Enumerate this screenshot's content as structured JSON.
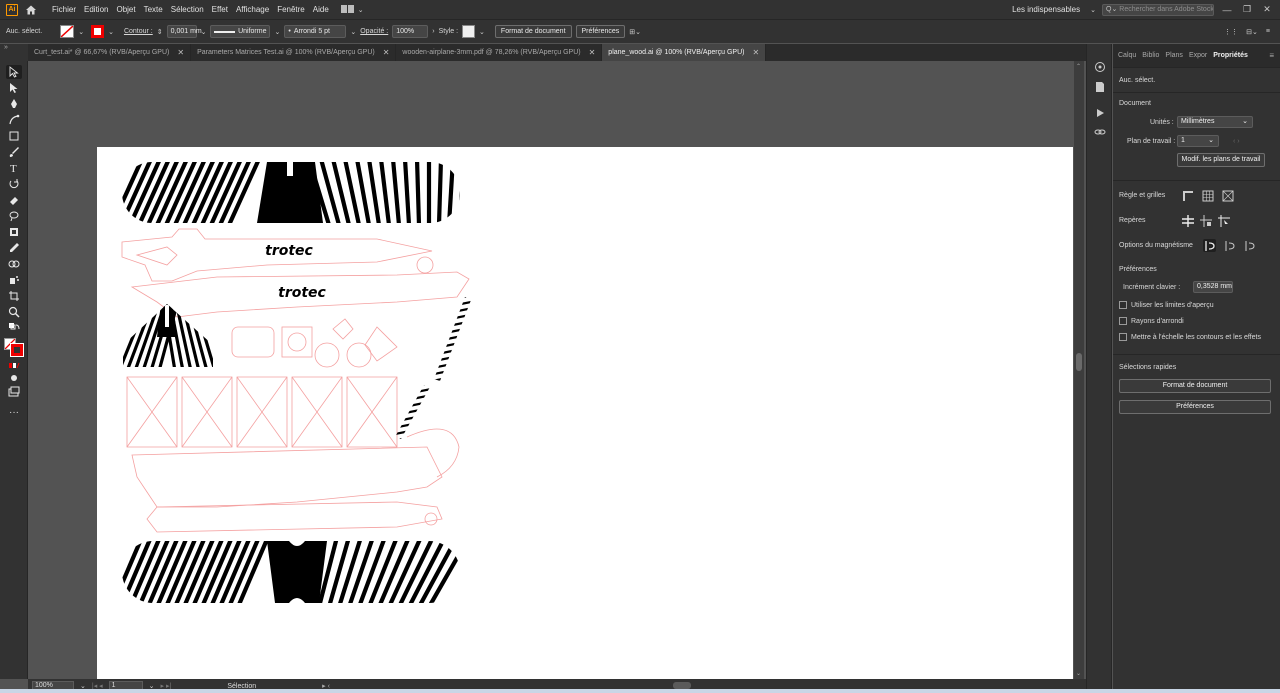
{
  "app": {
    "logo": "Ai"
  },
  "menu": [
    "Fichier",
    "Edition",
    "Objet",
    "Texte",
    "Sélection",
    "Effet",
    "Affichage",
    "Fenêtre",
    "Aide"
  ],
  "workspace": {
    "label": "Les indispensables",
    "search_placeholder": "Rechercher dans Adobe Stock"
  },
  "control": {
    "selection": "Auc. sélect.",
    "stroke_label": "Contour :",
    "stroke_weight": "0,001 mm",
    "profile": "Uniforme",
    "brush": "Arrondi 5 pt",
    "opacity_label": "Opacité :",
    "opacity": "100%",
    "style_label": "Style :",
    "doc_setup": "Format de document",
    "prefs": "Préférences"
  },
  "tabs": [
    {
      "label": "Curt_test.ai* @ 66,67% (RVB/Aperçu GPU)"
    },
    {
      "label": "Parameters Matrices Test.ai @ 100% (RVB/Aperçu GPU)"
    },
    {
      "label": "wooden-airplane-3mm.pdf @ 78,26% (RVB/Aperçu GPU)"
    },
    {
      "label": "plane_wood.ai @ 100% (RVB/Aperçu GPU)"
    }
  ],
  "artwork": {
    "text1": "trotec",
    "text2": "trotec"
  },
  "status": {
    "zoom": "100%",
    "artboard": "1",
    "tool": "Sélection"
  },
  "panel": {
    "tabs": [
      "Calqu",
      "Biblio",
      "Plans",
      "Expor",
      "Propriétés"
    ],
    "no_selection": "Auc. sélect.",
    "document_title": "Document",
    "units_label": "Unités :",
    "units_value": "Millimètres",
    "artboard_label": "Plan de travail :",
    "artboard_value": "1",
    "edit_artboards": "Modif. les plans de travail",
    "rulers_grids": "Règle et grilles",
    "guides": "Repères",
    "snap_options": "Options du magnétisme",
    "preferences_title": "Préférences",
    "key_increment_label": "Incrément clavier :",
    "key_increment_value": "0,3528 mm",
    "check1": "Utiliser les limites d'aperçu",
    "check2": "Rayons d'arrondi",
    "check3": "Mettre à l'échelle les contours et les effets",
    "quick_actions": "Sélections rapides",
    "btn_doc": "Format de document",
    "btn_prefs": "Préférences"
  },
  "colors": {
    "accent": "#ff9a00",
    "cut_line": "#f4a0a0",
    "artboard": "#ffffff"
  }
}
